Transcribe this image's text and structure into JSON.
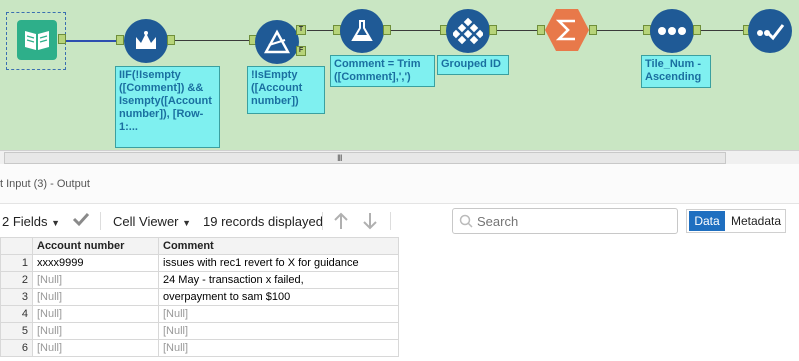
{
  "canvas": {
    "annotations": [
      "IIF(!Isempty\n([Comment]) &&\nIsempty([Account\nnumber]), [Row-\n1:...",
      "!IsEmpty\n([Account\nnumber])",
      "Comment = Trim\n([Comment],',')",
      "Grouped ID",
      "Tile_Num -\nAscending"
    ],
    "filter_true_label": "T",
    "filter_false_label": "F",
    "icons": {
      "input": "book-icon",
      "multirow": "crown-icon",
      "filter": "triangle-filter-icon",
      "formula": "flask-icon",
      "tile": "diamond-grid-icon",
      "summarize": "sigma-icon",
      "record_id": "dots-icon",
      "select": "checkmark-icon"
    },
    "colors": {
      "canvas_bg": "#c9e6c3",
      "tool_blue": "#1f5a96",
      "annotation_bg": "#7ff0f0",
      "summarize_orange": "#e8794a"
    }
  },
  "scrollbar": {
    "grip": "III"
  },
  "results": {
    "title": "t Input (3) - Output"
  },
  "toolbar": {
    "fields_label": "2 Fields",
    "viewer_label": "Cell Viewer",
    "records_label": "19 records displayed",
    "search_placeholder": "Search",
    "tab_data": "Data",
    "tab_metadata": "Metadata"
  },
  "grid": {
    "columns": [
      "Account number",
      "Comment"
    ],
    "rows": [
      {
        "n": "1",
        "account": "xxxx9999",
        "comment": "issues with rec1 revert fo X for guidance"
      },
      {
        "n": "2",
        "account": "[Null]",
        "comment": "24 May - transaction x failed,"
      },
      {
        "n": "3",
        "account": "[Null]",
        "comment": "overpayment to sam $100"
      },
      {
        "n": "4",
        "account": "[Null]",
        "comment": "[Null]"
      },
      {
        "n": "5",
        "account": "[Null]",
        "comment": "[Null]"
      },
      {
        "n": "6",
        "account": "[Null]",
        "comment": "[Null]"
      }
    ]
  }
}
